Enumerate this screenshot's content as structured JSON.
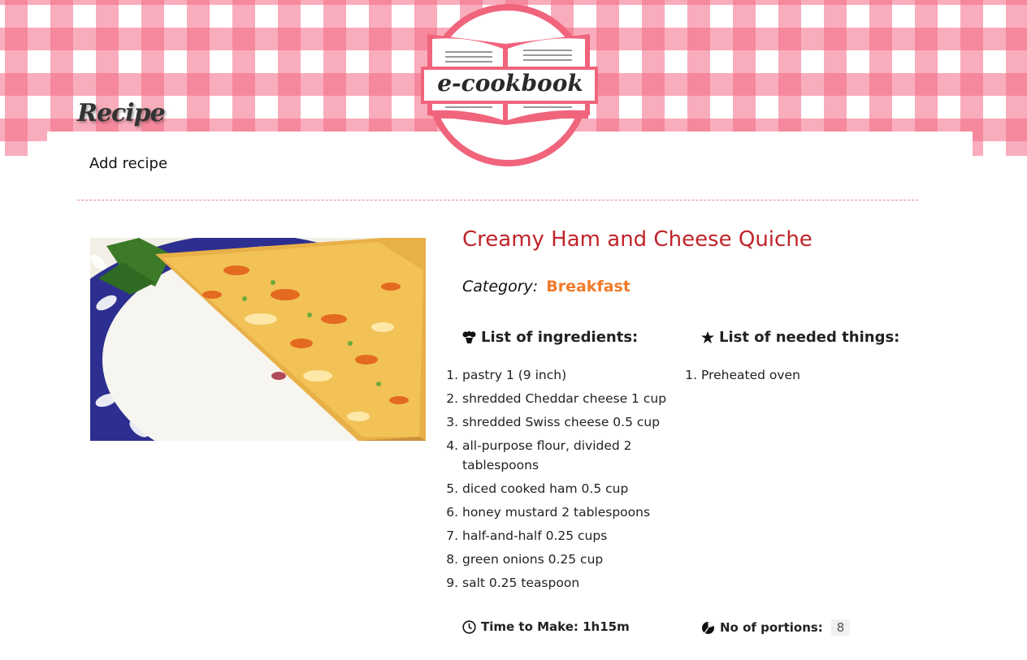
{
  "header": {
    "logo_text": "e-cookbook",
    "nav_title": "Recipe",
    "add_recipe_label": "Add recipe"
  },
  "recipe": {
    "title": "Creamy Ham and Cheese Quiche",
    "category_label": "Category:",
    "category_value": "Breakfast",
    "ingredients_heading": "List of ingredients:",
    "ingredients": [
      "pastry 1 (9 inch)",
      "shredded Cheddar cheese 1 cup",
      "shredded Swiss cheese 0.5 cup",
      "all-purpose flour, divided 2 tablespoons",
      "diced cooked ham 0.5 cup",
      "honey mustard 2 tablespoons",
      "half-and-half 0.25 cups",
      "green onions 0.25 cup",
      "salt 0.25 teaspoon"
    ],
    "things_heading": "List of needed things:",
    "things": [
      "Preheated oven"
    ],
    "time_label": "Time to Make: 1h15m",
    "portions_label": "No of portions:",
    "portions_value": "8"
  },
  "colors": {
    "accent_pink": "#f46a84",
    "title_red": "#c0242a",
    "category_orange": "#f07a2a"
  },
  "icons": [
    "book-logo-icon",
    "chef-hat-icon",
    "star-icon",
    "clock-icon",
    "pie-icon"
  ]
}
